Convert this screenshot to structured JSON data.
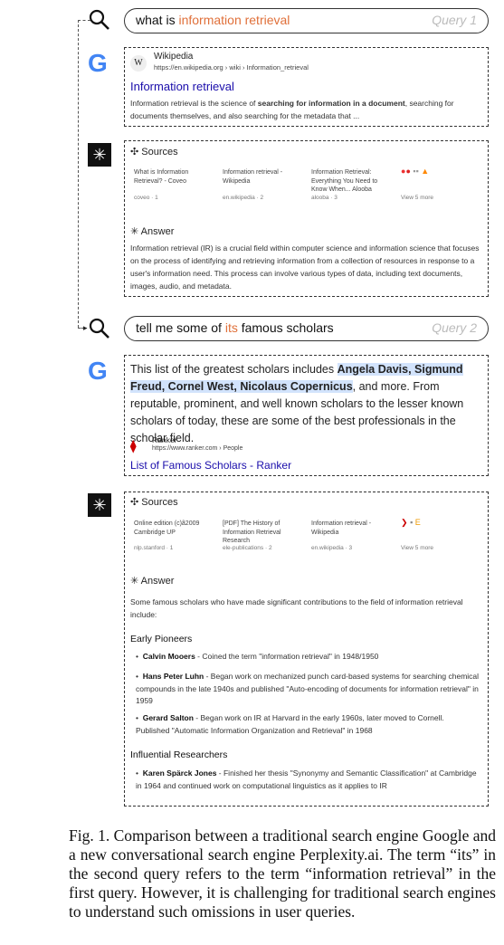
{
  "query1": {
    "prefix": "what is ",
    "highlight": "information retrieval",
    "label": "Query 1"
  },
  "query2": {
    "prefix": "tell me some of ",
    "highlight": "its",
    "suffix": " famous scholars",
    "label": "Query 2"
  },
  "google_logo": "G",
  "perplexity_logo": "✳",
  "g1": {
    "site": "Wikipedia",
    "url": "https://en.wikipedia.org › wiki › Information_retrieval",
    "title": "Information retrieval",
    "snippet_a": "Information retrieval is the science of ",
    "snippet_bold": "searching for information in a document",
    "snippet_b": ", searching for documents themselves, and also searching for the metadata that ..."
  },
  "p1": {
    "sources_label": "Sources",
    "sources": [
      {
        "title": "What is Information Retrieval? - Coveo",
        "foot": "coveo · 1"
      },
      {
        "title": "Information retrieval - Wikipedia",
        "foot": "en.wikipedia · 2"
      },
      {
        "title": "Information Retrieval: Everything You Need to Know When... Alooba",
        "foot": "alooba · 3"
      },
      {
        "title": "",
        "foot": "View 5 more"
      }
    ],
    "answer_label": "Answer",
    "answer": "Information retrieval (IR) is a crucial field within computer science and information science that focuses on the process of identifying and retrieving information from a collection of resources in response to a user's information need. This process can involve various types of data, including text documents, images, audio, and metadata."
  },
  "g2": {
    "text_a": "This list of the greatest scholars includes ",
    "text_hl": "Angela Davis, Sigmund Freud, Cornel West, Nicolaus Copernicus",
    "text_b": ", and more. From reputable, prominent, and well known scholars to the lesser known scholars of today, these are some of the best professionals in the scholar field.",
    "site": "Ranker",
    "url": "https://www.ranker.com › People",
    "title": "List of Famous Scholars - Ranker"
  },
  "p2": {
    "sources_label": "Sources",
    "sources": [
      {
        "title": "Online edition (c)ã2009 Cambridge UP",
        "foot": "nlp.stanford · 1"
      },
      {
        "title": "[PDF] The History of Information Retrieval Research",
        "foot": "ele-publications · 2"
      },
      {
        "title": "Information retrieval - Wikipedia",
        "foot": "en.wikipedia · 3"
      },
      {
        "title": "",
        "foot": "View 5 more"
      }
    ],
    "answer_label": "Answer",
    "intro": "Some famous scholars who have made significant contributions to the field of information retrieval include:",
    "section1": "Early Pioneers",
    "bullets1": [
      {
        "name": "Calvin Mooers",
        "text": " - Coined the term \"information retrieval\" in 1948/1950"
      },
      {
        "name": "Hans Peter Luhn",
        "text": " - Began work on mechanized punch card-based systems for searching chemical compounds in the late 1940s and published \"Auto-encoding of documents for information retrieval\" in 1959"
      },
      {
        "name": "Gerard Salton",
        "text": " - Began work on IR at Harvard in the early 1960s, later moved to Cornell. Published \"Automatic Information Organization and Retrieval\" in 1968"
      }
    ],
    "section2": "Influential Researchers",
    "bullets2": [
      {
        "name": "Karen Spärck Jones",
        "text": " - Finished her thesis \"Synonymy and Semantic Classification\" at Cambridge in 1964 and continued work on computational linguistics as it applies to IR"
      }
    ]
  },
  "caption": "Fig. 1. Comparison between a traditional search engine Google and a new conversational search engine Perplexity.ai. The term “its” in the second query refers to the term “information retrieval” in the first query. However, it is challenging for traditional search engines to understand such omissions in user queries."
}
